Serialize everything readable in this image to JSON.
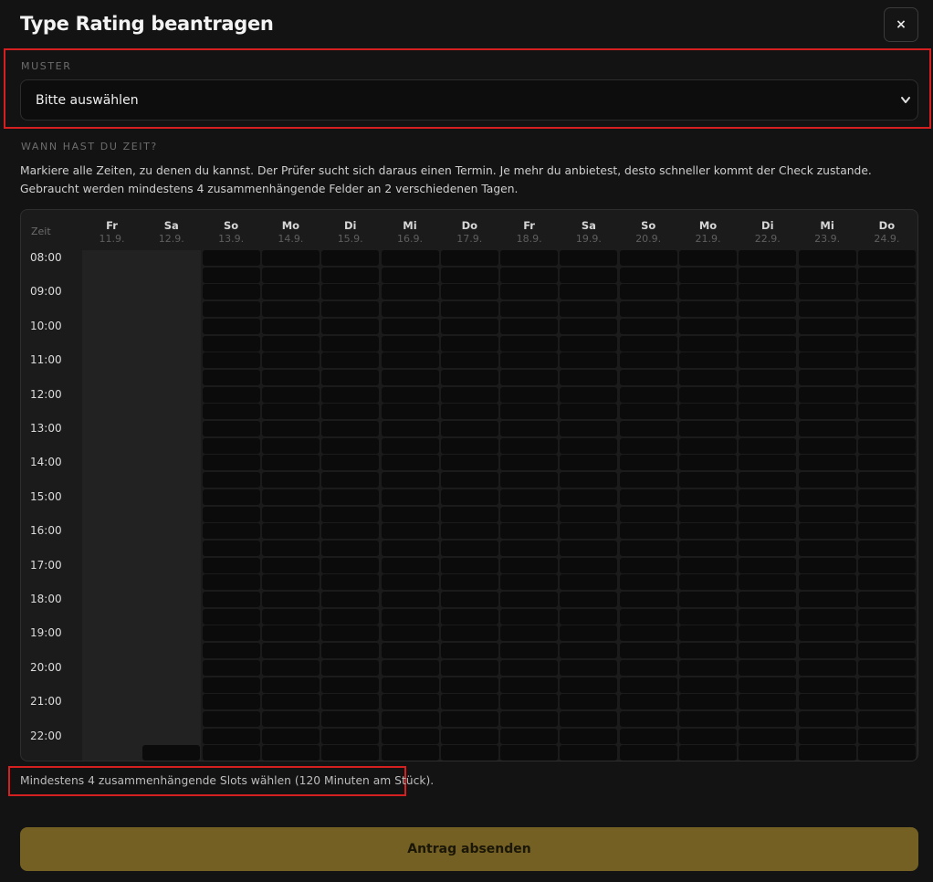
{
  "modal": {
    "title": "Type Rating beantragen",
    "close_label": "×"
  },
  "muster": {
    "label": "MUSTER",
    "selected": "Bitte auswählen"
  },
  "availability": {
    "label": "WANN HAST DU ZEIT?",
    "description": "Markiere alle Zeiten, zu denen du kannst. Der Prüfer sucht sich daraus einen Termin. Je mehr du anbietest, desto schneller kommt der Check zustande. Gebraucht werden mindestens 4 zusammenhängende Felder an 2 verschiedenen Tagen."
  },
  "schedule": {
    "time_header": "Zeit",
    "days": [
      {
        "name": "Fr",
        "date": "11.9.",
        "disabled": true
      },
      {
        "name": "Sa",
        "date": "12.9.",
        "disabled": true
      },
      {
        "name": "So",
        "date": "13.9.",
        "disabled": false
      },
      {
        "name": "Mo",
        "date": "14.9.",
        "disabled": false
      },
      {
        "name": "Di",
        "date": "15.9.",
        "disabled": false
      },
      {
        "name": "Mi",
        "date": "16.9.",
        "disabled": false
      },
      {
        "name": "Do",
        "date": "17.9.",
        "disabled": false
      },
      {
        "name": "Fr",
        "date": "18.9.",
        "disabled": false
      },
      {
        "name": "Sa",
        "date": "19.9.",
        "disabled": false
      },
      {
        "name": "So",
        "date": "20.9.",
        "disabled": false
      },
      {
        "name": "Mo",
        "date": "21.9.",
        "disabled": false
      },
      {
        "name": "Di",
        "date": "22.9.",
        "disabled": false
      },
      {
        "name": "Mi",
        "date": "23.9.",
        "disabled": false
      },
      {
        "name": "Do",
        "date": "24.9.",
        "disabled": false
      }
    ],
    "hours": [
      "08:00",
      "09:00",
      "10:00",
      "11:00",
      "12:00",
      "13:00",
      "14:00",
      "15:00",
      "16:00",
      "17:00",
      "18:00",
      "19:00",
      "20:00",
      "21:00",
      "22:00"
    ],
    "slots_per_hour": 2,
    "extra_available_cells": [
      {
        "day": 1,
        "slot": 29
      }
    ]
  },
  "hint": "Mindestens 4 zusammenhängende Slots wählen (120 Minuten am Stück).",
  "submit_label": "Antrag absenden",
  "colors": {
    "accent": "#736022",
    "highlight": "#d42020",
    "background": "#131313"
  }
}
